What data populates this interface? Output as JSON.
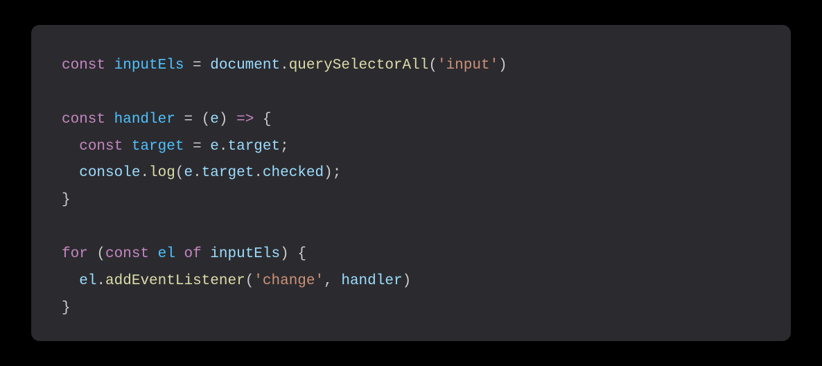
{
  "code": {
    "tokens": [
      [
        {
          "t": "const ",
          "c": "kw"
        },
        {
          "t": "inputEls",
          "c": "const-decl"
        },
        {
          "t": " = ",
          "c": "punct"
        },
        {
          "t": "document",
          "c": "var"
        },
        {
          "t": ".",
          "c": "punct"
        },
        {
          "t": "querySelectorAll",
          "c": "fn"
        },
        {
          "t": "(",
          "c": "punct"
        },
        {
          "t": "'input'",
          "c": "str"
        },
        {
          "t": ")",
          "c": "punct"
        }
      ],
      [],
      [
        {
          "t": "const ",
          "c": "kw"
        },
        {
          "t": "handler",
          "c": "const-decl"
        },
        {
          "t": " = (",
          "c": "punct"
        },
        {
          "t": "e",
          "c": "var"
        },
        {
          "t": ") ",
          "c": "punct"
        },
        {
          "t": "=>",
          "c": "kw"
        },
        {
          "t": " {",
          "c": "punct"
        }
      ],
      [
        {
          "t": "  ",
          "c": "punct"
        },
        {
          "t": "const ",
          "c": "kw"
        },
        {
          "t": "target",
          "c": "const-decl"
        },
        {
          "t": " = ",
          "c": "punct"
        },
        {
          "t": "e",
          "c": "var"
        },
        {
          "t": ".",
          "c": "punct"
        },
        {
          "t": "target",
          "c": "prop"
        },
        {
          "t": ";",
          "c": "punct"
        }
      ],
      [
        {
          "t": "  ",
          "c": "punct"
        },
        {
          "t": "console",
          "c": "var"
        },
        {
          "t": ".",
          "c": "punct"
        },
        {
          "t": "log",
          "c": "fn"
        },
        {
          "t": "(",
          "c": "punct"
        },
        {
          "t": "e",
          "c": "var"
        },
        {
          "t": ".",
          "c": "punct"
        },
        {
          "t": "target",
          "c": "prop"
        },
        {
          "t": ".",
          "c": "punct"
        },
        {
          "t": "checked",
          "c": "prop"
        },
        {
          "t": ");",
          "c": "punct"
        }
      ],
      [
        {
          "t": "}",
          "c": "punct"
        }
      ],
      [],
      [
        {
          "t": "for ",
          "c": "kw"
        },
        {
          "t": "(",
          "c": "punct"
        },
        {
          "t": "const ",
          "c": "kw"
        },
        {
          "t": "el",
          "c": "const-decl"
        },
        {
          "t": " ",
          "c": "punct"
        },
        {
          "t": "of ",
          "c": "kw"
        },
        {
          "t": "inputEls",
          "c": "var"
        },
        {
          "t": ") {",
          "c": "punct"
        }
      ],
      [
        {
          "t": "  ",
          "c": "punct"
        },
        {
          "t": "el",
          "c": "var"
        },
        {
          "t": ".",
          "c": "punct"
        },
        {
          "t": "addEventListener",
          "c": "fn"
        },
        {
          "t": "(",
          "c": "punct"
        },
        {
          "t": "'change'",
          "c": "str"
        },
        {
          "t": ", ",
          "c": "punct"
        },
        {
          "t": "handler",
          "c": "var"
        },
        {
          "t": ")",
          "c": "punct"
        }
      ],
      [
        {
          "t": "}",
          "c": "punct"
        }
      ]
    ]
  }
}
